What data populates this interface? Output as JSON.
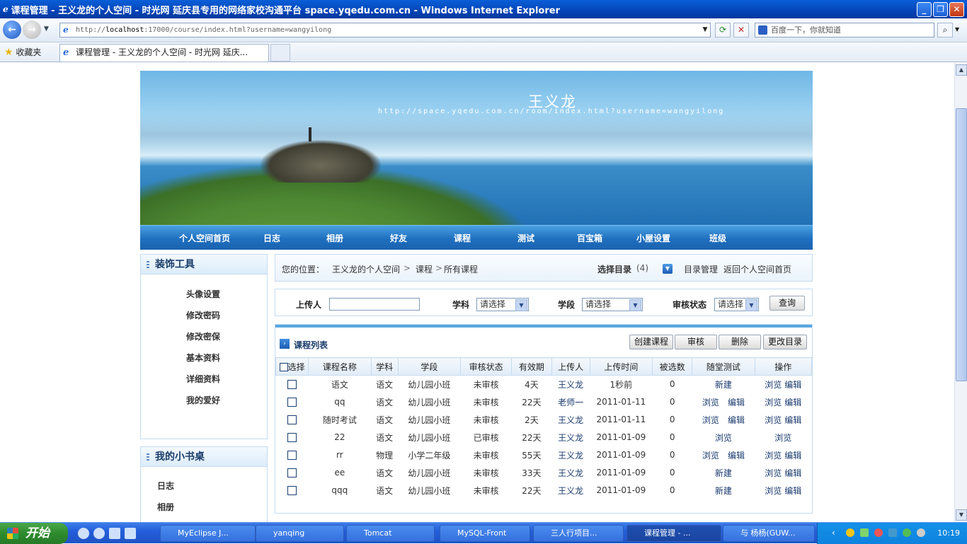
{
  "window": {
    "title": "课程管理 - 王义龙的个人空间 - 时光网 延庆县专用的网络家校沟通平台 space.yqedu.com.cn - Windows Internet Explorer",
    "min": "_",
    "max": "❐",
    "close": "✕"
  },
  "browser": {
    "url_prefix": "http://",
    "url_host": "localhost",
    "url_rest": ":17000/course/index.html?username=wangyilong",
    "search_placeholder": "百度一下，你就知道",
    "favorites_label": "收藏夹",
    "tab_title": "课程管理 - 王义龙的个人空间 - 时光网 延庆..."
  },
  "banner": {
    "owner_name": "王义龙",
    "space_url": "http://space.yqedu.com.cn/room/index.html?username=wangyilong"
  },
  "nav": {
    "items": [
      "个人空间首页",
      "日志",
      "相册",
      "好友",
      "课程",
      "测试",
      "百宝箱",
      "小屋设置",
      "班级"
    ]
  },
  "sidebar": {
    "decor_title": "装饰工具",
    "decor_items": [
      "头像设置",
      "修改密码",
      "修改密保",
      "基本资料",
      "详细资料",
      "我的爱好"
    ],
    "desk_title": "我的小书桌",
    "desk_items": [
      "日志",
      "相册"
    ]
  },
  "breadcrumb": {
    "label": "您的位置：",
    "home": "王义龙的个人空间",
    "sep1": ">",
    "section": "课程",
    "sep2": ">",
    "current": "所有课程",
    "select_dir": "选择目录",
    "dir_count": "(4)",
    "dir_manage": "目录管理",
    "back_home": "返回个人空间首页"
  },
  "filter": {
    "uploader_label": "上传人",
    "subject_label": "学科",
    "subject_value": "请选择",
    "stage_label": "学段",
    "stage_value": "请选择",
    "status_label": "审核状态",
    "status_value": "请选择",
    "query_button": "查询"
  },
  "course_list": {
    "title": "课程列表",
    "actions": [
      "创建课程",
      "审核",
      "删除",
      "更改目录"
    ],
    "columns": [
      "选择",
      "课程名称",
      "学科",
      "学段",
      "审核状态",
      "有效期",
      "上传人",
      "上传时间",
      "被选数",
      "随堂测试",
      "操作"
    ],
    "rows": [
      {
        "name": "语文",
        "subject": "语文",
        "stage": "幼儿园小班",
        "status": "未审核",
        "validity": "4天",
        "uploader": "王义龙",
        "time": "1秒前",
        "selected": "0",
        "test": [
          "新建"
        ],
        "ops": [
          "浏览",
          "编辑"
        ]
      },
      {
        "name": "qq",
        "subject": "语文",
        "stage": "幼儿园小班",
        "status": "未审核",
        "validity": "22天",
        "uploader": "老师一",
        "time": "2011-01-11",
        "selected": "0",
        "test": [
          "浏览",
          "编辑"
        ],
        "ops": [
          "浏览",
          "编辑"
        ]
      },
      {
        "name": "随时考试",
        "subject": "语文",
        "stage": "幼儿园小班",
        "status": "未审核",
        "validity": "2天",
        "uploader": "王义龙",
        "time": "2011-01-11",
        "selected": "0",
        "test": [
          "浏览",
          "编辑"
        ],
        "ops": [
          "浏览",
          "编辑"
        ]
      },
      {
        "name": "22",
        "subject": "语文",
        "stage": "幼儿园小班",
        "status": "已审核",
        "validity": "22天",
        "uploader": "王义龙",
        "time": "2011-01-09",
        "selected": "0",
        "test": [
          "浏览"
        ],
        "ops": [
          "浏览"
        ]
      },
      {
        "name": "rr",
        "subject": "物理",
        "stage": "小学二年级",
        "status": "未审核",
        "validity": "55天",
        "uploader": "王义龙",
        "time": "2011-01-09",
        "selected": "0",
        "test": [
          "浏览",
          "编辑"
        ],
        "ops": [
          "浏览",
          "编辑"
        ]
      },
      {
        "name": "ee",
        "subject": "语文",
        "stage": "幼儿园小班",
        "status": "未审核",
        "validity": "33天",
        "uploader": "王义龙",
        "time": "2011-01-09",
        "selected": "0",
        "test": [
          "新建"
        ],
        "ops": [
          "浏览",
          "编辑"
        ]
      },
      {
        "name": "qqq",
        "subject": "语文",
        "stage": "幼儿园小班",
        "status": "未审核",
        "validity": "22天",
        "uploader": "王义龙",
        "time": "2011-01-09",
        "selected": "0",
        "test": [
          "新建"
        ],
        "ops": [
          "浏览",
          "编辑"
        ]
      }
    ]
  },
  "taskbar": {
    "start": "开始",
    "items": [
      "MyEclipse J...",
      "yanqing",
      "Tomcat",
      "MySQL-Front",
      "三人行项目...",
      "课程管理 - ...",
      "与 杨杨(GUW..."
    ],
    "clock": "10:19"
  },
  "colors": {
    "accent": "#1f6fbf",
    "titlebar": "#0444b8",
    "link": "#1a3a6e"
  }
}
